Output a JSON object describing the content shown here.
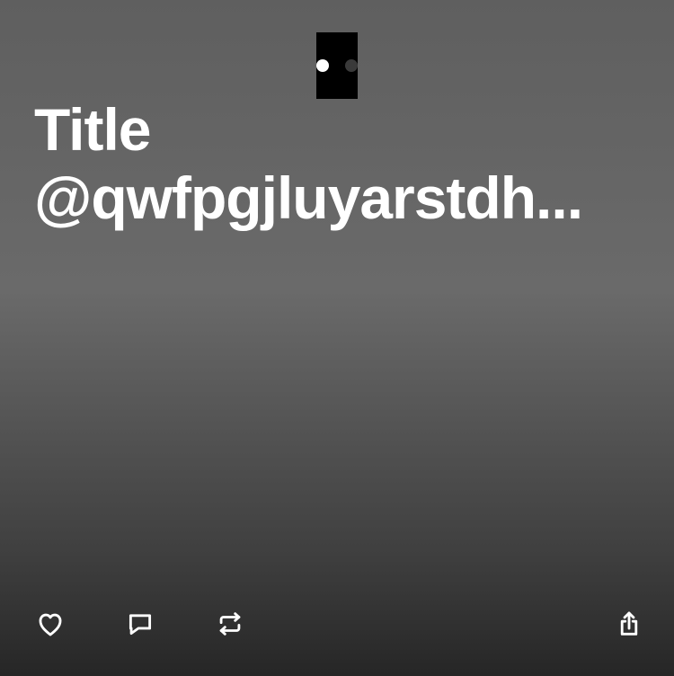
{
  "title": {
    "line1": "Title",
    "line2": "@qwfpgjluyarstdh..."
  },
  "pager": {
    "count": 2,
    "active_index": 0
  },
  "actions": {
    "like_icon": "heart-icon",
    "comment_icon": "comment-icon",
    "retweet_icon": "retweet-icon",
    "share_icon": "share-icon"
  },
  "colors": {
    "text": "#ffffff",
    "pager_background": "#000000",
    "pager_dot_active": "#ffffff",
    "pager_dot_inactive": "#3a3a3a",
    "gradient_top": "#5f5f5f",
    "gradient_bottom": "#262626"
  }
}
